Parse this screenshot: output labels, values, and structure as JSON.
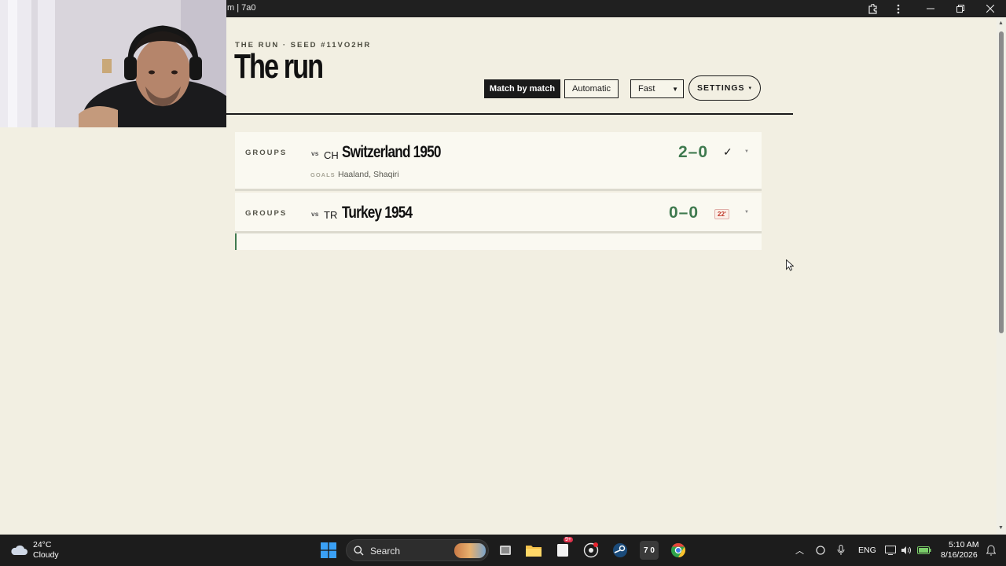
{
  "window": {
    "title": "m | 7a0",
    "controls": {
      "extension_icon": "puzzle-icon",
      "menu_icon": "kebab-icon"
    }
  },
  "page": {
    "kicker": "THE RUN · SEED #11VO2HR",
    "title": "The run"
  },
  "controls": {
    "match_by_match": "Match by match",
    "automatic": "Automatic",
    "speed_selected": "Fast",
    "settings": "SETTINGS",
    "settings_caret": "▾"
  },
  "matches": [
    {
      "stage": "GROUPS",
      "vs": "vs",
      "code": "CH",
      "opponent": "Switzerland 1950",
      "score": "2–0",
      "status": "✓",
      "goals_label": "GOALS",
      "goals": "Haaland, Shaqiri"
    },
    {
      "stage": "GROUPS",
      "vs": "vs",
      "code": "TR",
      "opponent": "Turkey 1954",
      "score": "0–0",
      "minute": "22'"
    }
  ],
  "taskbar": {
    "weather": {
      "temp": "24°C",
      "condition": "Cloudy"
    },
    "search_placeholder": "Search",
    "apps": [
      "windows-start",
      "search",
      "widgets-news",
      "task-view",
      "file-explorer",
      "notepad",
      "obs-studio",
      "steam",
      "7a0-app",
      "chrome"
    ],
    "notification_badge": "9+",
    "app_label_7a0": "7 0",
    "language": "ENG",
    "time": "5:10 AM",
    "date": "8/16/2026"
  },
  "colors": {
    "background": "#f2efe2",
    "score_green": "#3f7a4f",
    "dark": "#1a1a1a",
    "minute_red": "#c0392b"
  }
}
